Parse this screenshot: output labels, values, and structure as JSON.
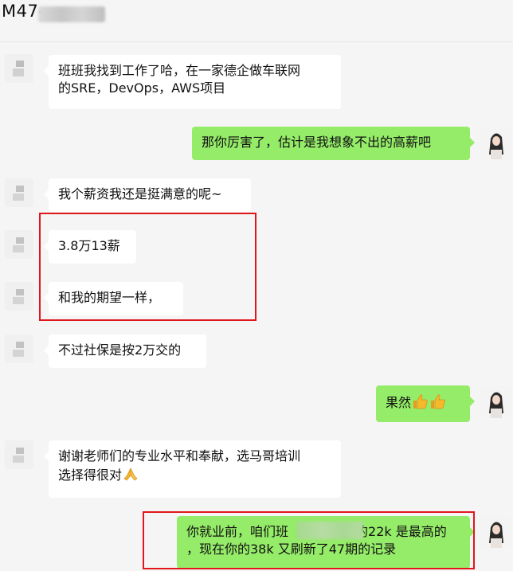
{
  "header": {
    "title": "M47-"
  },
  "messages": [
    {
      "side": "in",
      "lines": [
        "班班我找到工作了哈，在一家德企做车联网",
        "的SRE，DevOps，AWS项目"
      ]
    },
    {
      "side": "out",
      "lines": [
        "那你厉害了，估计是我想象不出的高薪吧"
      ]
    },
    {
      "side": "in",
      "lines": [
        "我个薪资我还是挺满意的呢~"
      ]
    },
    {
      "side": "in",
      "lines": [
        "3.8万13薪"
      ]
    },
    {
      "side": "in",
      "lines": [
        "和我的期望一样，"
      ]
    },
    {
      "side": "in",
      "lines": [
        "不过社保是按2万交的"
      ]
    },
    {
      "side": "out",
      "text": "果然",
      "emoji": "thumbs-up-icon"
    },
    {
      "side": "in",
      "lines": [
        "谢谢老师们的专业水平和奉献，选马哥培训",
        "选择得很对"
      ],
      "emoji": "praying-hands-icon"
    },
    {
      "side": "out",
      "line1_a": "你就业前，咱们班",
      "line1_b": "的22k 是最高的",
      "line2": "，现在你的38k 又刷新了47期的记录"
    }
  ],
  "colors": {
    "outgoing_bubble": "#95ec69",
    "incoming_bubble": "#ffffff",
    "background": "#f5f5f5",
    "highlight_box": "#e0161b"
  }
}
